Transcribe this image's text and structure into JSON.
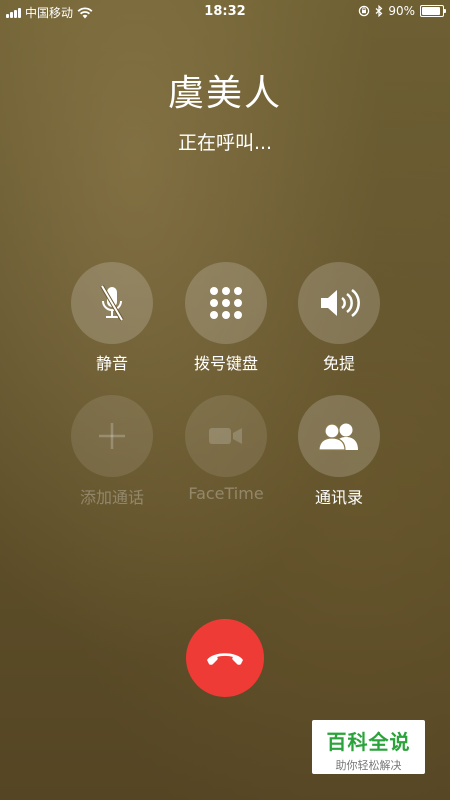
{
  "status_bar": {
    "carrier": "中国移动",
    "time": "18:32",
    "battery": "90%",
    "battery_level": 0.9
  },
  "caller": {
    "name": "虞美人",
    "status": "正在呼叫..."
  },
  "buttons": [
    {
      "label": "静音",
      "icon": "microphone-muted-icon",
      "enabled": true
    },
    {
      "label": "拨号键盘",
      "icon": "keypad-icon",
      "enabled": true
    },
    {
      "label": "免提",
      "icon": "speaker-icon",
      "enabled": true
    },
    {
      "label": "添加通话",
      "icon": "plus-icon",
      "enabled": false
    },
    {
      "label": "FaceTime",
      "icon": "video-camera-icon",
      "enabled": false
    },
    {
      "label": "通讯录",
      "icon": "contacts-icon",
      "enabled": true
    }
  ],
  "end_call": {
    "icon": "hang-up-icon",
    "color": "#ef3b36"
  },
  "watermark": {
    "title": "百科全说",
    "subtitle": "助你轻松解决",
    "color": "#2aa33a"
  }
}
